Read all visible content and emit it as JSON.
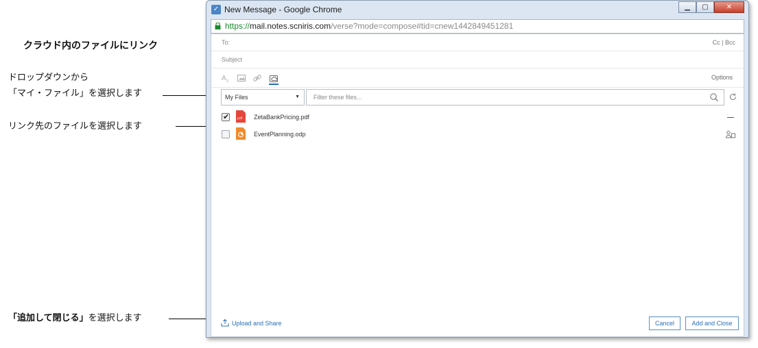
{
  "annotations": {
    "heading": "クラウド内のファイルにリンク",
    "dropdown_line1": "ドロップダウンから",
    "dropdown_line2": "「マイ・ファイル」を選択します",
    "select_file": "リンク先のファイルを選択します",
    "add_close_bold": "「追加して閉じる」",
    "add_close_rest": "を選択します"
  },
  "window": {
    "title": "New Message - Google Chrome"
  },
  "address": {
    "scheme": "https://",
    "host": "mail.notes.scniris.com",
    "path": "/verse?mode=compose#tid=cnew1442849451281"
  },
  "compose": {
    "to_label": "To:",
    "cc_bcc": "Cc | Bcc",
    "subject_label": "Subject",
    "options_label": "Options"
  },
  "file_picker": {
    "source_selected": "My Files",
    "filter_placeholder": "Filter these files...",
    "files": [
      {
        "name": "ZetaBankPricing.pdf",
        "checked": true,
        "type": "pdf"
      },
      {
        "name": "EventPlanning.odp",
        "checked": false,
        "type": "presentation"
      }
    ]
  },
  "footer": {
    "upload_label": "Upload and Share",
    "cancel_label": "Cancel",
    "add_close_label": "Add and Close"
  },
  "colors": {
    "accent": "#2a6eb5",
    "pdf_icon": "#e5463a",
    "presentation_icon": "#f08a2c",
    "https_green": "#1a8a2e"
  }
}
